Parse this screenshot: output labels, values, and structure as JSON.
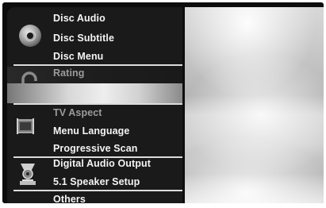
{
  "menu": {
    "groups": [
      {
        "icon": "disc-icon",
        "items": [
          "Disc Audio",
          "Disc Subtitle",
          "Disc Menu"
        ]
      },
      {
        "icon": "lock-icon",
        "items": [
          "Rating",
          ""
        ]
      },
      {
        "icon": "tv-icon",
        "items": [
          "TV Aspect",
          "Menu Language",
          "Progressive Scan"
        ]
      },
      {
        "icon": "speaker-icon",
        "items": [
          "Digital Audio Output",
          "5.1 Speaker Setup"
        ]
      },
      {
        "icon": "",
        "items": [
          "Others"
        ]
      }
    ],
    "selected_item_index": 1,
    "selected_group_index": 1
  },
  "colors": {
    "menu_bg": "#1a1a1a",
    "text_active": "#f4f4f4",
    "text_dim": "#9c9c9c",
    "highlight": "#eeeeee"
  }
}
